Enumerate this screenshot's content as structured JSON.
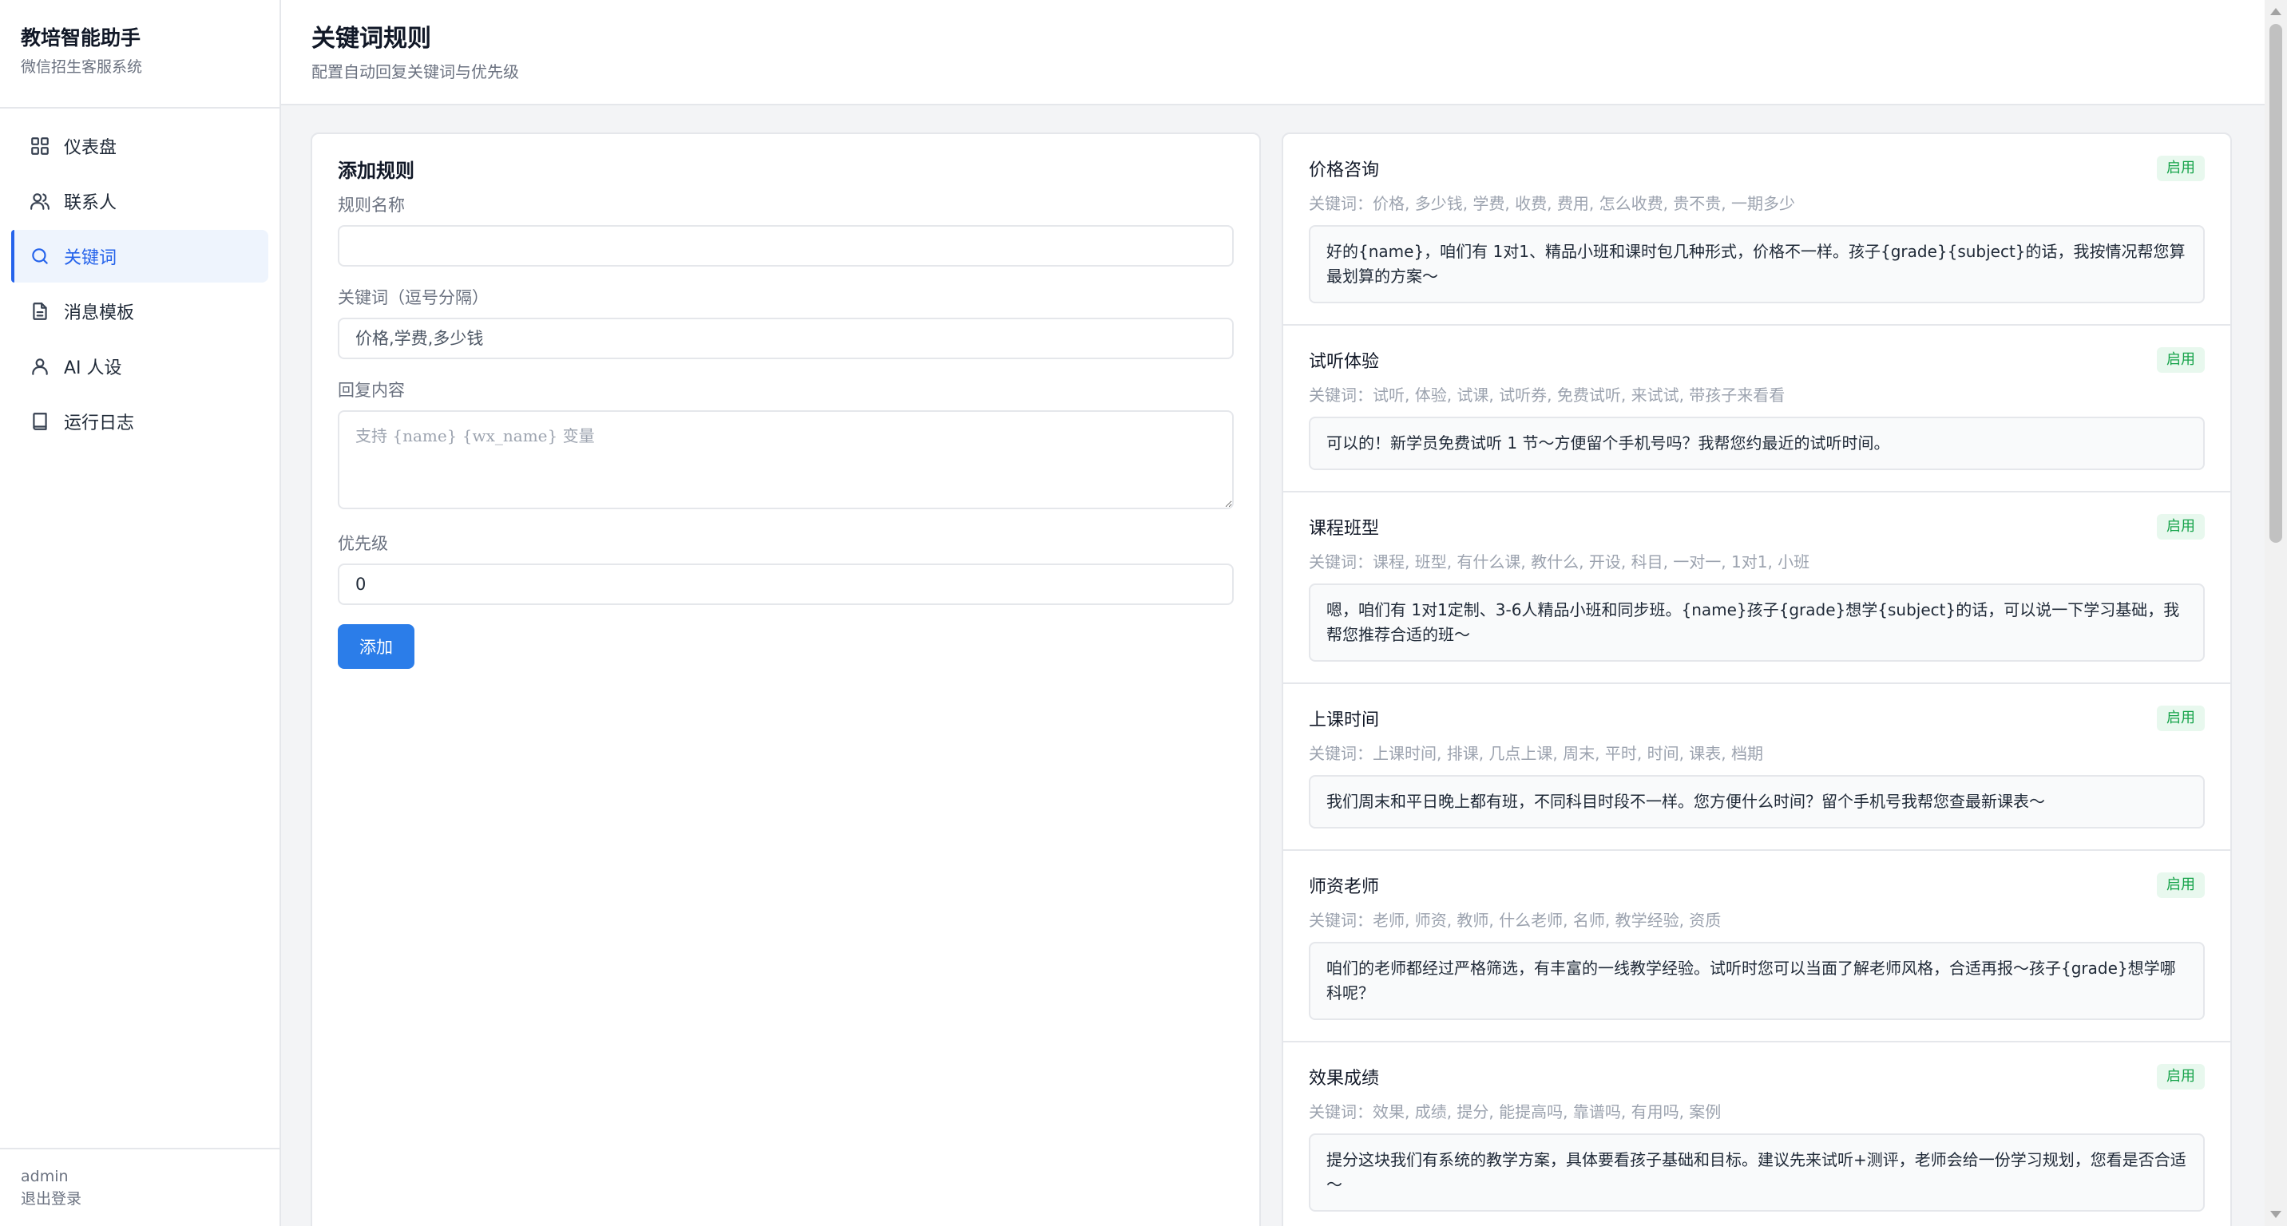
{
  "sidebar": {
    "brand_title": "教培智能助手",
    "brand_subtitle": "微信招生客服系统",
    "items": [
      {
        "label": "仪表盘",
        "icon": "grid-icon"
      },
      {
        "label": "联系人",
        "icon": "users-icon"
      },
      {
        "label": "关键词",
        "icon": "search-icon",
        "active": true
      },
      {
        "label": "消息模板",
        "icon": "document-icon"
      },
      {
        "label": "AI 人设",
        "icon": "user-icon"
      },
      {
        "label": "运行日志",
        "icon": "book-icon"
      }
    ],
    "user": "admin",
    "logout": "退出登录"
  },
  "header": {
    "title": "关键词规则",
    "subtitle": "配置自动回复关键词与优先级"
  },
  "form": {
    "title": "添加规则",
    "name_label": "规则名称",
    "name_value": "",
    "keywords_label": "关键词（逗号分隔）",
    "keywords_placeholder": "价格,学费,多少钱",
    "reply_label": "回复内容",
    "reply_placeholder": "支持 {name} {wx_name} 变量",
    "priority_label": "优先级",
    "priority_value": "0",
    "submit_label": "添加"
  },
  "rules": [
    {
      "name": "价格咨询",
      "status": "启用",
      "keywords": "关键词：价格, 多少钱, 学费, 收费, 费用, 怎么收费, 贵不贵, 一期多少",
      "reply": "好的{name}，咱们有 1对1、精品小班和课时包几种形式，价格不一样。孩子{grade}{subject}的话，我按情况帮您算最划算的方案～"
    },
    {
      "name": "试听体验",
      "status": "启用",
      "keywords": "关键词：试听, 体验, 试课, 试听券, 免费试听, 来试试, 带孩子来看看",
      "reply": "可以的！新学员免费试听 1 节～方便留个手机号吗？我帮您约最近的试听时间。"
    },
    {
      "name": "课程班型",
      "status": "启用",
      "keywords": "关键词：课程, 班型, 有什么课, 教什么, 开设, 科目, 一对一, 1对1, 小班",
      "reply": "嗯，咱们有 1对1定制、3-6人精品小班和同步班。{name}孩子{grade}想学{subject}的话，可以说一下学习基础，我帮您推荐合适的班～"
    },
    {
      "name": "上课时间",
      "status": "启用",
      "keywords": "关键词：上课时间, 排课, 几点上课, 周末, 平时, 时间, 课表, 档期",
      "reply": "我们周末和平日晚上都有班，不同科目时段不一样。您方便什么时间？留个手机号我帮您查最新课表～"
    },
    {
      "name": "师资老师",
      "status": "启用",
      "keywords": "关键词：老师, 师资, 教师, 什么老师, 名师, 教学经验, 资质",
      "reply": "咱们的老师都经过严格筛选，有丰富的一线教学经验。试听时您可以当面了解老师风格，合适再报～孩子{grade}想学哪科呢？"
    },
    {
      "name": "效果成绩",
      "status": "启用",
      "keywords": "关键词：效果, 成绩, 提分, 能提高吗, 靠谱吗, 有用吗, 案例",
      "reply": "提分这块我们有系统的教学方案，具体要看孩子基础和目标。建议先来试听+测评，老师会给一份学习规划，您看是否合适～"
    }
  ],
  "colors": {
    "accent": "#2563eb",
    "button": "#2b7de9",
    "status_text": "#16a34a",
    "status_bg": "#e8f8ee"
  }
}
